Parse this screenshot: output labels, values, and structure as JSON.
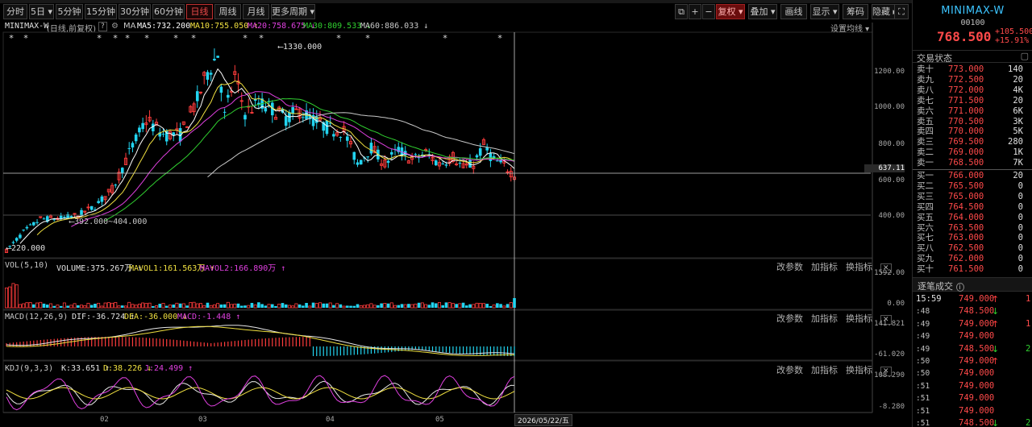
{
  "toolbar": {
    "left_buttons": [
      {
        "label": "分时",
        "active": false
      },
      {
        "label": "5日 ▾",
        "active": false
      },
      {
        "label": "5分钟",
        "active": false
      },
      {
        "label": "15分钟",
        "active": false
      },
      {
        "label": "30分钟",
        "active": false
      },
      {
        "label": "60分钟",
        "active": false
      },
      {
        "label": "日线",
        "active": true
      },
      {
        "label": "周线",
        "active": false
      },
      {
        "label": "月线",
        "active": false
      },
      {
        "label": "更多周期 ▾",
        "active": false
      }
    ],
    "right_buttons": [
      {
        "label": "复权 ▾"
      },
      {
        "label": "叠加 ▾"
      },
      {
        "label": "画线"
      },
      {
        "label": "显示 ▾"
      },
      {
        "label": "筹码"
      },
      {
        "label": "隐藏 ▸▸"
      }
    ]
  },
  "indicator_line": {
    "name": "MINIMAX-W",
    "period": "(日线,前复权)",
    "ma_label": "MA",
    "ma5": "MA5:732.200",
    "ma10": "MA10:755.050 ↑",
    "ma20": "MA20:758.675 ↓",
    "ma30": "MA30:809.533 ↓",
    "ma60": "MA60:886.033 ↓",
    "settings": "设置均线 ▾"
  },
  "main_chart": {
    "y_ticks": [
      "1200.00",
      "1000.00",
      "800.00",
      "600.00",
      "400.00"
    ],
    "crosshair_value": "637.11",
    "high_annotation": "1330.000",
    "low_annotation": "220.000",
    "range_annotation": "392.000~404.000"
  },
  "x_axis": {
    "ticks": [
      "02",
      "03",
      "04",
      "05"
    ],
    "cursor_date": "2026/05/22/五"
  },
  "vol_pane": {
    "label": "VOL(5,10)",
    "volume": "VOLUME:375.267万 ↑",
    "mavol1": "MAVOL1:161.563万 ↑",
    "mavol2": "MAVOL2:166.890万 ↑",
    "y_top": "1592.00",
    "y_bottom": "0.00"
  },
  "macd_pane": {
    "label": "MACD(12,26,9)",
    "dif": "DIF:-36.724 ↑",
    "dea": "DEA:-36.000 ↓",
    "macd": "MACD:-1.448 ↑",
    "y_top": "141.821",
    "y_bottom": "-61.020"
  },
  "kdj_pane": {
    "label": "KDJ(9,3,3)",
    "k": "K:33.651 ↑",
    "d": "D:38.226 ↓",
    "j": "J:24.499 ↑",
    "y_top": "108.290",
    "y_bottom": "-8.280"
  },
  "pane_tools": {
    "param": "改参数",
    "add": "加指标",
    "swap": "换指标",
    "close": "✕"
  },
  "quote": {
    "name": "MINIMAX-W",
    "code": "00100",
    "price": "768.500",
    "change": "+105.500",
    "change_pct": "+15.91%",
    "status_label": "交易状态",
    "asks": [
      {
        "label": "卖十",
        "price": "773.000",
        "vol": "140"
      },
      {
        "label": "卖九",
        "price": "772.500",
        "vol": "20"
      },
      {
        "label": "卖八",
        "price": "772.000",
        "vol": "4K"
      },
      {
        "label": "卖七",
        "price": "771.500",
        "vol": "20"
      },
      {
        "label": "卖六",
        "price": "771.000",
        "vol": "6K"
      },
      {
        "label": "卖五",
        "price": "770.500",
        "vol": "3K"
      },
      {
        "label": "卖四",
        "price": "770.000",
        "vol": "5K"
      },
      {
        "label": "卖三",
        "price": "769.500",
        "vol": "280"
      },
      {
        "label": "卖二",
        "price": "769.000",
        "vol": "1K"
      },
      {
        "label": "卖一",
        "price": "768.500",
        "vol": "7K"
      }
    ],
    "bids": [
      {
        "label": "买一",
        "price": "766.000",
        "vol": "20"
      },
      {
        "label": "买二",
        "price": "765.500",
        "vol": "0"
      },
      {
        "label": "买三",
        "price": "765.000",
        "vol": "0"
      },
      {
        "label": "买四",
        "price": "764.500",
        "vol": "0"
      },
      {
        "label": "买五",
        "price": "764.000",
        "vol": "0"
      },
      {
        "label": "买六",
        "price": "763.500",
        "vol": "0"
      },
      {
        "label": "买七",
        "price": "763.000",
        "vol": "0"
      },
      {
        "label": "买八",
        "price": "762.500",
        "vol": "0"
      },
      {
        "label": "买九",
        "price": "762.000",
        "vol": "0"
      },
      {
        "label": "买十",
        "price": "761.500",
        "vol": "0"
      }
    ]
  },
  "trades": {
    "title": "逐笔成交",
    "rows": [
      {
        "time": "15:59",
        "price": "749.000",
        "dir": "up",
        "qty": "1"
      },
      {
        "time": ":48",
        "price": "748.500",
        "dir": "down",
        "qty": ""
      },
      {
        "time": ":49",
        "price": "749.000",
        "dir": "up",
        "qty": "1"
      },
      {
        "time": ":49",
        "price": "749.000",
        "dir": "",
        "qty": ""
      },
      {
        "time": ":49",
        "price": "748.500",
        "dir": "down",
        "qty": "2"
      },
      {
        "time": ":50",
        "price": "749.000",
        "dir": "up",
        "qty": ""
      },
      {
        "time": ":50",
        "price": "749.000",
        "dir": "",
        "qty": ""
      },
      {
        "time": ":51",
        "price": "749.000",
        "dir": "",
        "qty": ""
      },
      {
        "time": ":51",
        "price": "749.000",
        "dir": "",
        "qty": ""
      },
      {
        "time": ":51",
        "price": "749.000",
        "dir": "",
        "qty": ""
      },
      {
        "time": ":51",
        "price": "748.500",
        "dir": "down",
        "qty": "2"
      }
    ]
  },
  "colors": {
    "up": "#ff3c3c",
    "down": "#22d4f0",
    "ma5": "#ffffff",
    "ma10": "#f0e040",
    "ma20": "#e040e0",
    "ma30": "#30d030",
    "ma60": "#c8c8c8"
  },
  "chart_data": {
    "type": "candlestick",
    "series": [
      {
        "name": "MA5",
        "value": 732.2
      },
      {
        "name": "MA10",
        "value": 755.05
      },
      {
        "name": "MA20",
        "value": 758.675
      },
      {
        "name": "MA30",
        "value": 809.533
      },
      {
        "name": "MA60",
        "value": 886.033
      }
    ],
    "high": 1330.0,
    "low": 220.0,
    "last_close": 637.11,
    "ylim": [
      200,
      1450
    ]
  }
}
